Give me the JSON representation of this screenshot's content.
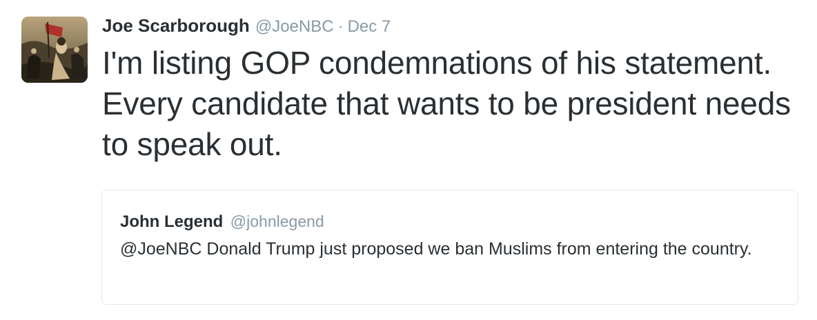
{
  "tweet": {
    "author_name": "Joe Scarborough",
    "author_handle": "@JoeNBC",
    "separator": "·",
    "date": "Dec 7",
    "text": "I'm listing GOP condemnations of his statement. Every candidate that wants to be president needs to speak out.",
    "avatar_icon": "painting-avatar-icon"
  },
  "quoted_tweet": {
    "author_name": "John Legend",
    "author_handle": "@johnlegend",
    "text": "@JoeNBC Donald Trump just proposed we ban Muslims from entering the country."
  },
  "colors": {
    "text_primary": "#292f33",
    "text_secondary": "#8899a6",
    "border": "#e1e8ed"
  }
}
